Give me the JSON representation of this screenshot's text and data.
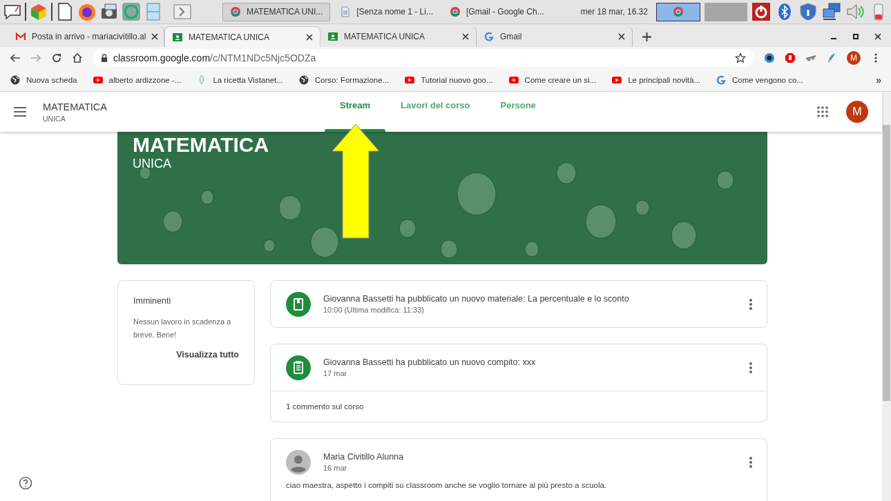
{
  "taskbar": {
    "windows": [
      {
        "title": "MATEMATICA UNI...",
        "selected": true
      },
      {
        "title": "[Senza nome 1 - Li...",
        "selected": false
      },
      {
        "title": "[Gmail - Google Ch...",
        "selected": false
      }
    ],
    "clock": "mer 18 mar, 16.32"
  },
  "browser": {
    "tabs": [
      {
        "title": "Posta in arrivo - mariacivitillo.al",
        "selected": false
      },
      {
        "title": "MATEMATICA UNICA",
        "selected": true
      },
      {
        "title": "MATEMATICA UNICA",
        "selected": false
      },
      {
        "title": "Gmail",
        "selected": false
      }
    ],
    "url": {
      "host": "classroom.google.com",
      "path": "/c/NTM1NDc5Njc5ODZa"
    },
    "profile": "M",
    "bookmarks": [
      {
        "label": "Nuova scheda"
      },
      {
        "label": "alberto ardizzone -..."
      },
      {
        "label": "La ricetta Vistanet..."
      },
      {
        "label": "Corso: Formazione..."
      },
      {
        "label": "Tutorial nuovo goo..."
      },
      {
        "label": "Come creare un si..."
      },
      {
        "label": "Le principali novità..."
      },
      {
        "label": "Come vengono co..."
      }
    ],
    "more": "»"
  },
  "header": {
    "title": "MATEMATICA",
    "section": "UNICA",
    "nav": [
      {
        "label": "Stream",
        "selected": true
      },
      {
        "label": "Lavori del corso",
        "selected": false
      },
      {
        "label": "Persone",
        "selected": false
      }
    ],
    "avatar": "M"
  },
  "banner": {
    "title": "MATEMATICA",
    "subtitle": "UNICA"
  },
  "upcoming": {
    "title": "Imminenti",
    "text": "Nessun lavoro in scadenza a breve. Bene!",
    "link": "Visualizza tutto"
  },
  "posts": [
    {
      "kind": "material",
      "title": "Giovanna Bassetti ha pubblicato un nuovo materiale: La percentuale e lo sconto",
      "date": "10:00 (Ultima modifica: 11:33)"
    },
    {
      "kind": "assignment",
      "title": "Giovanna Bassetti ha pubblicato un nuovo compito: xxx",
      "date": "17 mar",
      "comments": "1 commento sul corso"
    },
    {
      "kind": "user",
      "title": "Maria Civitillo Alunna",
      "date": "16 mar",
      "body": "ciao maestra, aspetto i compiti su classroom anche se voglio tornare al più presto a scuola."
    }
  ]
}
